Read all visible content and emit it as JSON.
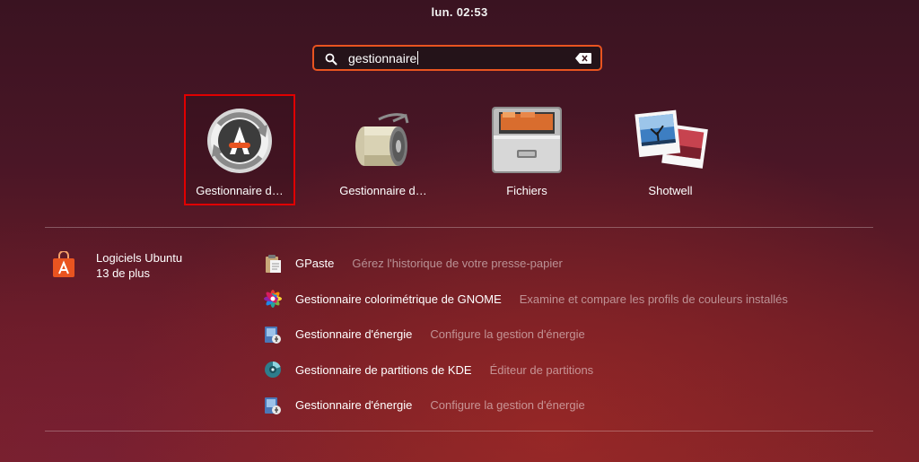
{
  "top_bar": {
    "clock": "lun. 02:53"
  },
  "search": {
    "query": "gestionnaire"
  },
  "apps": [
    {
      "label": "Gestionnaire d…",
      "icon": "software-updater-icon",
      "selected": true
    },
    {
      "label": "Gestionnaire d…",
      "icon": "disk-roller-icon",
      "selected": false
    },
    {
      "label": "Fichiers",
      "icon": "file-cabinet-icon",
      "selected": false
    },
    {
      "label": "Shotwell",
      "icon": "photos-icon",
      "selected": false
    }
  ],
  "category": {
    "name": "Logiciels Ubuntu",
    "more": "13 de plus",
    "icon": "ubuntu-software-bag-icon"
  },
  "results": [
    {
      "name": "GPaste",
      "description": "Gérez l'historique de votre presse-papier",
      "icon": "clipboard-icon"
    },
    {
      "name": "Gestionnaire colorimétrique de GNOME",
      "description": "Examine et compare les profils de couleurs installés",
      "icon": "color-manager-icon"
    },
    {
      "name": "Gestionnaire d'énergie",
      "description": "Configure la gestion d'énergie",
      "icon": "power-manager-icon"
    },
    {
      "name": "Gestionnaire de partitions de KDE",
      "description": "Éditeur de partitions",
      "icon": "partition-manager-icon"
    },
    {
      "name": "Gestionnaire d'énergie",
      "description": "Configure la gestion d'énergie",
      "icon": "power-manager-icon"
    }
  ],
  "colors": {
    "accent": "#e95420",
    "selection": "#e00000"
  }
}
